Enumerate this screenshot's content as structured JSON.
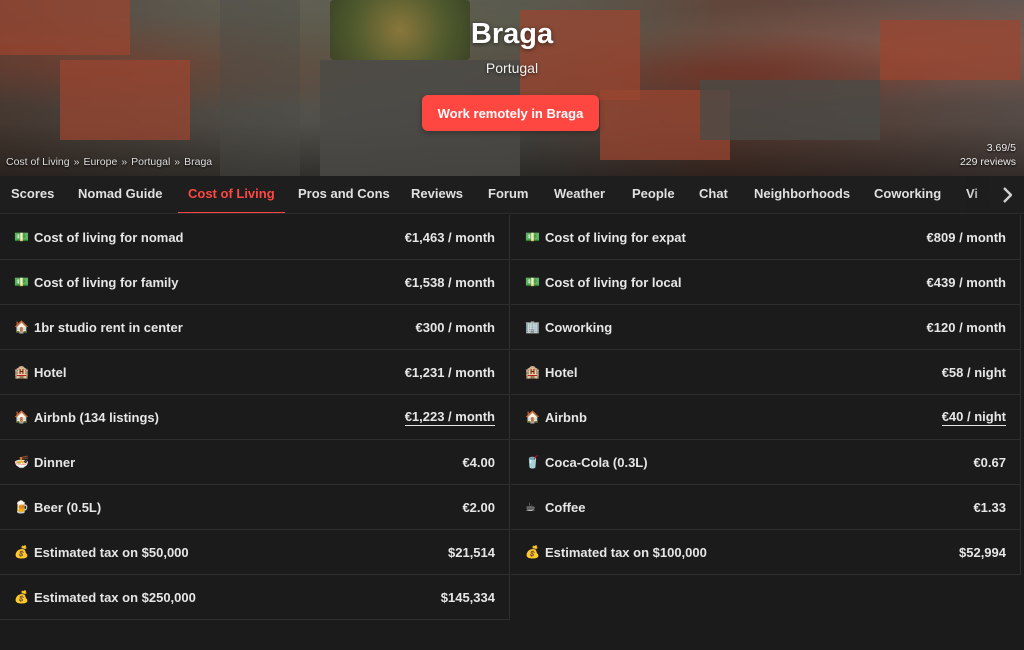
{
  "hero": {
    "title": "Braga",
    "subtitle": "Portugal",
    "cta_label": "Work remotely in Braga",
    "breadcrumb": [
      "Cost of Living",
      "Europe",
      "Portugal",
      "Braga"
    ],
    "breadcrumb_sep": "»",
    "rating": "3.69/5",
    "reviews": "229 reviews"
  },
  "tabs": [
    "Scores",
    "Nomad Guide",
    "Cost of Living",
    "Pros and Cons",
    "Reviews",
    "Forum",
    "Weather",
    "People",
    "Chat",
    "Neighborhoods",
    "Coworking",
    "Vi"
  ],
  "active_tab": "Cost of Living",
  "costs": {
    "left": [
      {
        "icon": "banknote-icon",
        "glyph": "💵",
        "label": "Cost of living for nomad",
        "value": "€1,463 / month"
      },
      {
        "icon": "banknote-icon",
        "glyph": "💵",
        "label": "Cost of living for family",
        "value": "€1,538 / month"
      },
      {
        "icon": "house-icon",
        "glyph": "🏠",
        "label": "1br studio rent in center",
        "value": "€300 / month"
      },
      {
        "icon": "hotel-icon",
        "glyph": "🏨",
        "label": "Hotel",
        "value": "€1,231 / month"
      },
      {
        "icon": "house-icon",
        "glyph": "🏠",
        "label": "Airbnb (134 listings)",
        "value": "€1,223 / month"
      },
      {
        "icon": "dinner-icon",
        "glyph": "🍜",
        "label": "Dinner",
        "value": "€4.00"
      },
      {
        "icon": "beer-icon",
        "glyph": "🍺",
        "label": "Beer (0.5L)",
        "value": "€2.00"
      },
      {
        "icon": "money-bag-icon",
        "glyph": "💰",
        "label": "Estimated tax on $50,000",
        "value": "$21,514"
      },
      {
        "icon": "money-bag-icon",
        "glyph": "💰",
        "label": "Estimated tax on $250,000",
        "value": "$145,334"
      }
    ],
    "right": [
      {
        "icon": "banknote-icon",
        "glyph": "💵",
        "label": "Cost of living for expat",
        "value": "€809 / month"
      },
      {
        "icon": "banknote-icon",
        "glyph": "💵",
        "label": "Cost of living for local",
        "value": "€439 / month"
      },
      {
        "icon": "office-icon",
        "glyph": "🏢",
        "label": "Coworking",
        "value": "€120 / month"
      },
      {
        "icon": "hotel-icon",
        "glyph": "🏨",
        "label": "Hotel",
        "value": "€58 / night"
      },
      {
        "icon": "house-icon",
        "glyph": "🏠",
        "label": "Airbnb",
        "value": "€40 / night"
      },
      {
        "icon": "soda-icon",
        "glyph": "🥤",
        "label": "Coca-Cola (0.3L)",
        "value": "€0.67"
      },
      {
        "icon": "coffee-icon",
        "glyph": "☕",
        "label": "Coffee",
        "value": "€1.33"
      },
      {
        "icon": "money-bag-icon",
        "glyph": "💰",
        "label": "Estimated tax on $100,000",
        "value": "$52,994"
      }
    ]
  },
  "colors": {
    "accent": "#ff4742",
    "background": "#1b1b1b"
  }
}
